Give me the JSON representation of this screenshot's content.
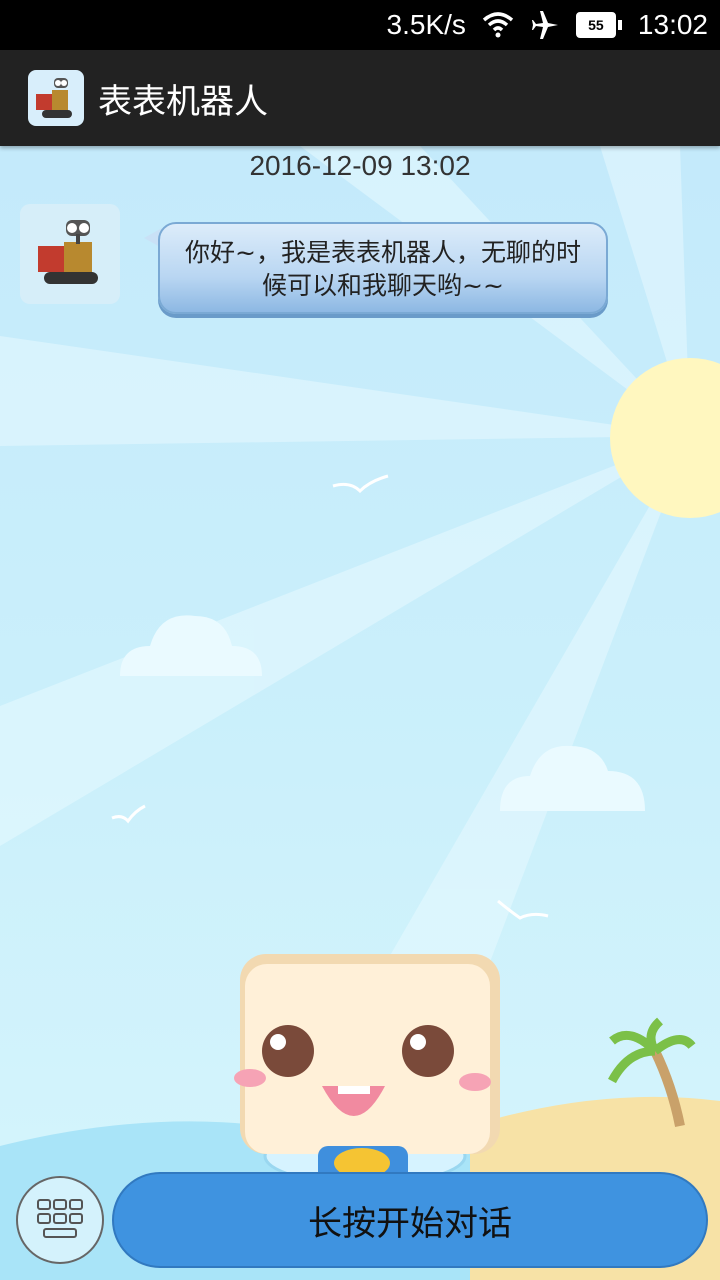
{
  "status_bar": {
    "net_speed": "3.5K/s",
    "battery": "55",
    "time": "13:02"
  },
  "app": {
    "title": "表表机器人"
  },
  "chat": {
    "timestamp": "2016-12-09 13:02",
    "message": "你好~，我是表表机器人，无聊的时候可以和我聊天哟~~"
  },
  "bottom_bar": {
    "talk_label": "长按开始对话"
  },
  "colors": {
    "talk_button": "#3f93e0",
    "sky": "#cdf0fb",
    "sun": "#fff7bf",
    "app_bar": "#222222"
  },
  "icons": [
    "wifi-icon",
    "airplane-mode-icon",
    "battery-icon",
    "robot-avatar-icon",
    "keyboard-icon"
  ]
}
